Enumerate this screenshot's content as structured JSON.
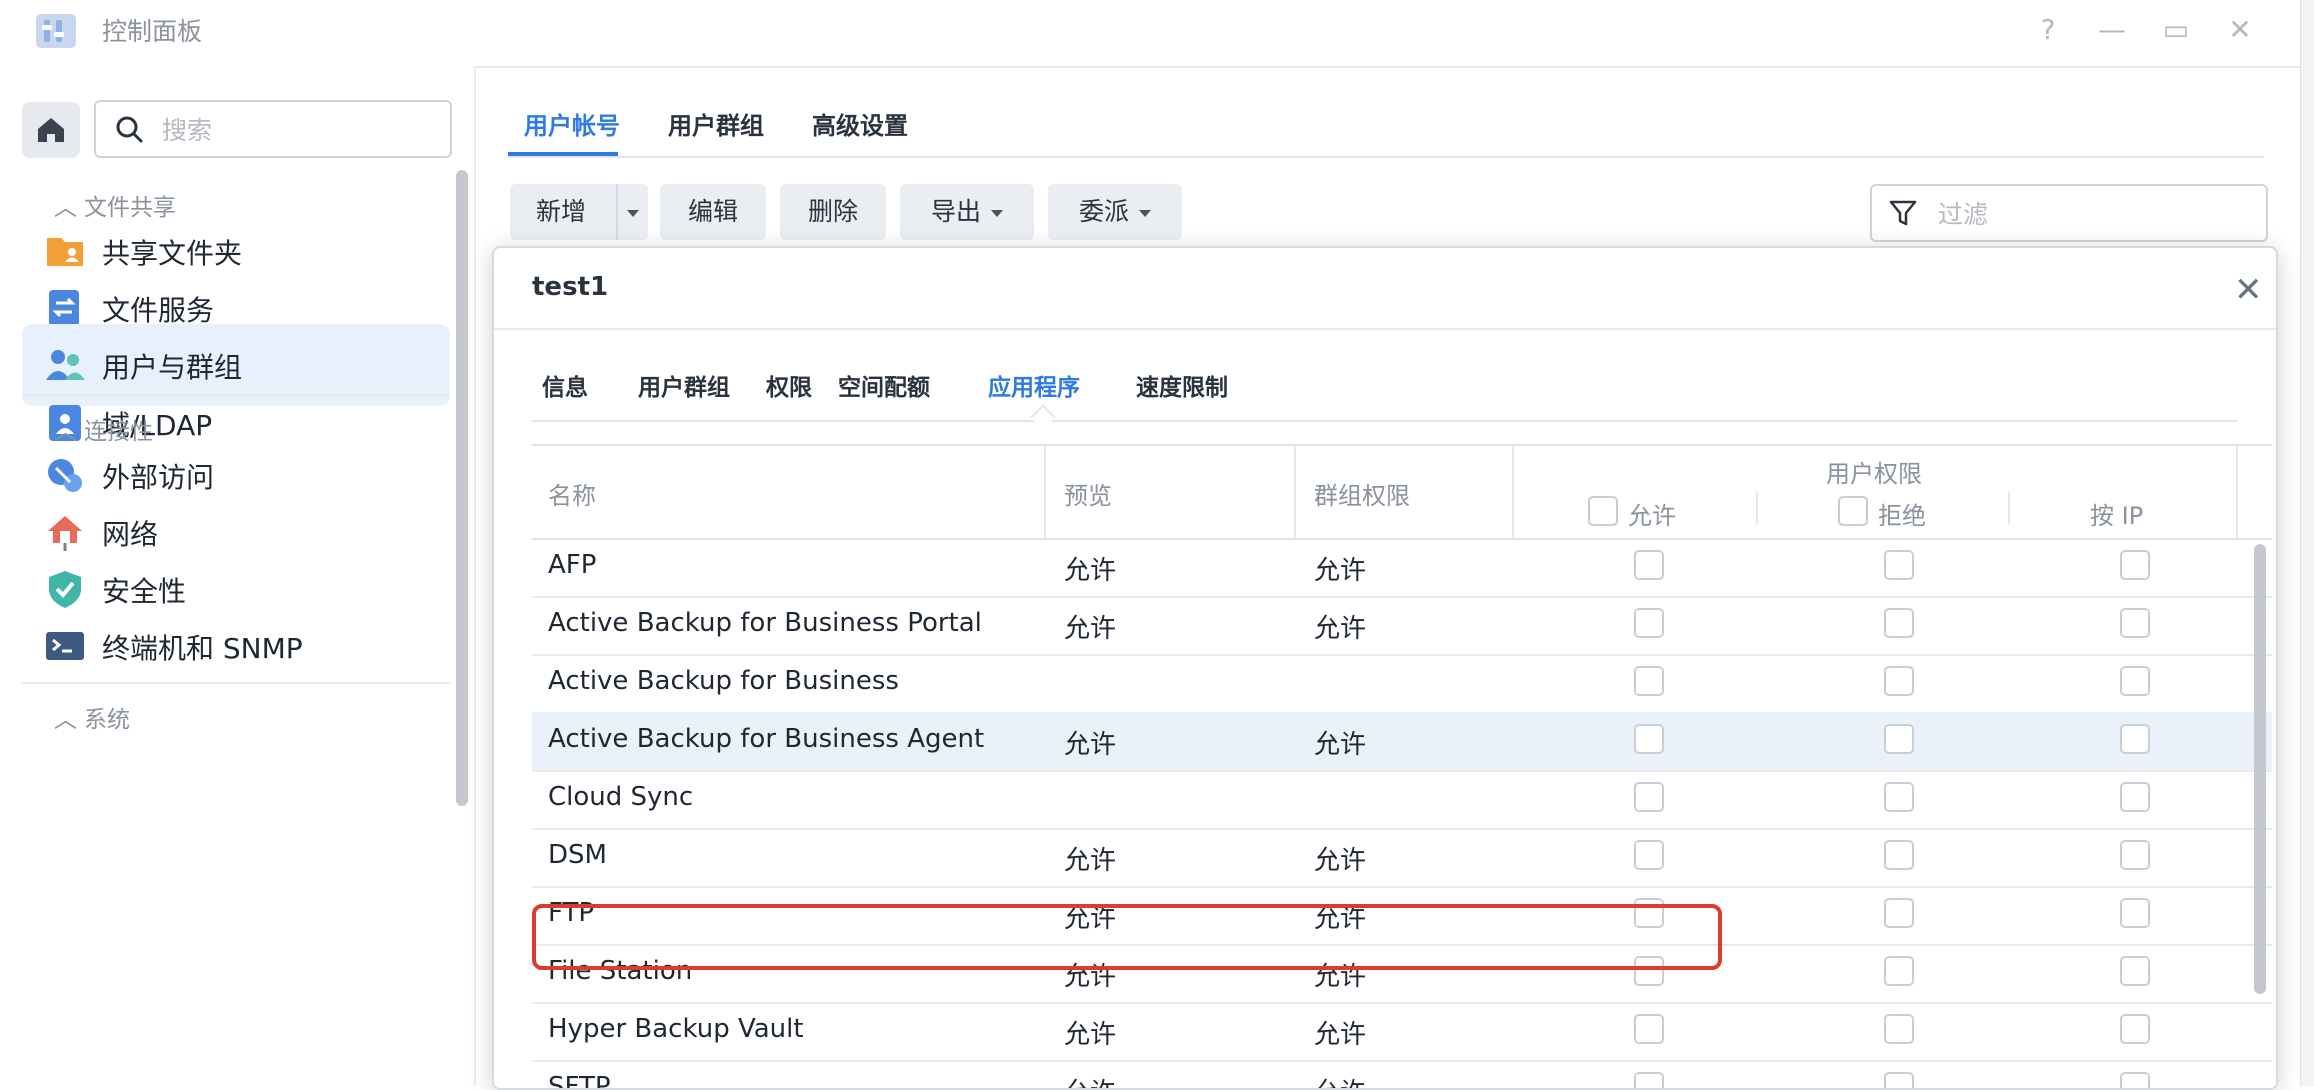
{
  "window": {
    "title": "控制面板",
    "buttons": {
      "help": "?",
      "minimize": "—",
      "maximize": "▭",
      "close": "✕"
    }
  },
  "sidebar": {
    "search_placeholder": "搜索",
    "sections": [
      {
        "label": "文件共享",
        "items": [
          "共享文件夹",
          "文件服务",
          "用户与群组",
          "域/LDAP"
        ]
      },
      {
        "label": "连接性",
        "items": [
          "外部访问",
          "网络",
          "安全性",
          "终端机和 SNMP"
        ]
      },
      {
        "label": "系统"
      }
    ],
    "active_item": "用户与群组"
  },
  "main": {
    "tabs": [
      "用户帐号",
      "用户群组",
      "高级设置"
    ],
    "active_tab": "用户帐号",
    "toolbar": {
      "create": "新增",
      "edit": "编辑",
      "delete": "删除",
      "export": "导出",
      "delegate": "委派"
    },
    "filter_placeholder": "过滤"
  },
  "dialog": {
    "title": "test1",
    "tabs": [
      "信息",
      "用户群组",
      "权限",
      "空间配额",
      "应用程序",
      "速度限制"
    ],
    "active_tab": "应用程序",
    "table": {
      "headers": {
        "name": "名称",
        "preview": "预览",
        "group_perm": "群组权限",
        "user_perm": "用户权限",
        "allow": "允许",
        "deny": "拒绝",
        "by_ip": "按 IP"
      },
      "rows": [
        {
          "name": "AFP",
          "preview": "允许",
          "group": "允许"
        },
        {
          "name": "Active Backup for Business Portal",
          "preview": "允许",
          "group": "允许"
        },
        {
          "name": "Active Backup for Business",
          "preview": "",
          "group": ""
        },
        {
          "name": "Active Backup for Business Agent",
          "preview": "允许",
          "group": "允许",
          "selected": true
        },
        {
          "name": "Cloud Sync",
          "preview": "",
          "group": ""
        },
        {
          "name": "DSM",
          "preview": "允许",
          "group": "允许"
        },
        {
          "name": "FTP",
          "preview": "允许",
          "group": "允许"
        },
        {
          "name": "File Station",
          "preview": "允许",
          "group": "允许"
        },
        {
          "name": "Hyper Backup Vault",
          "preview": "允许",
          "group": "允许"
        },
        {
          "name": "SFTP",
          "preview": "允许",
          "group": "允许"
        }
      ]
    }
  },
  "colors": {
    "accent": "#2f7be0",
    "highlight": "#de3b2f",
    "selected_row": "#eaf1fb"
  }
}
